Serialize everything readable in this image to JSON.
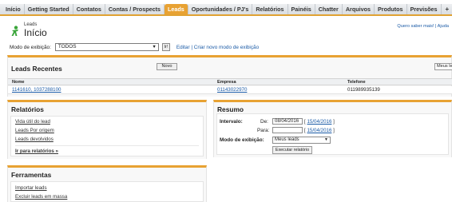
{
  "tabs": [
    "Início",
    "Getting Started",
    "Contatos",
    "Contas / Prospects",
    "Leads",
    "Oportunidades / PJ's",
    "Relatórios",
    "Painéis",
    "Chatter",
    "Arquivos",
    "Produtos",
    "Previsões",
    "+"
  ],
  "active_tab": "Leads",
  "header": {
    "kicker": "Leads",
    "title": "Início",
    "help_link": "Quero saber mais! | Ajuda"
  },
  "view": {
    "label": "Modo de exibição:",
    "selected": "TODOS",
    "go_label": "Ir!",
    "edit_link": "Editar",
    "create_link": "Criar novo modo de exibição"
  },
  "recent": {
    "title": "Leads Recentes",
    "new_label": "Novo",
    "select_value": "Meus leads",
    "columns": [
      "Nome",
      "Empresa",
      "Telefone"
    ],
    "rows": [
      {
        "name": "1141610, 1037288100",
        "company": "01143022970",
        "phone": "011989935139"
      }
    ]
  },
  "reports": {
    "title": "Relatórios",
    "links": [
      "Vida útil do lead",
      "Leads Por origem",
      "Leads devolvidos"
    ],
    "more_link": "Ir para relatórios »"
  },
  "tools": {
    "title": "Ferramentas",
    "links": [
      "Importar leads",
      "Excluir leads em massa"
    ]
  },
  "summary": {
    "title": "Resumo",
    "interval_label": "Intervalo:",
    "from_label": "De:",
    "from_value": "08/04/2016",
    "from_link": "15/04/2016",
    "to_label": "Para:",
    "to_value": "",
    "to_link": "15/04/2016",
    "mode_label": "Modo de exibição:",
    "mode_value": "Meus leads",
    "run_label": "Executar relatório"
  },
  "colors": {
    "accent": "#e8a233",
    "link": "#1a5aa6"
  }
}
